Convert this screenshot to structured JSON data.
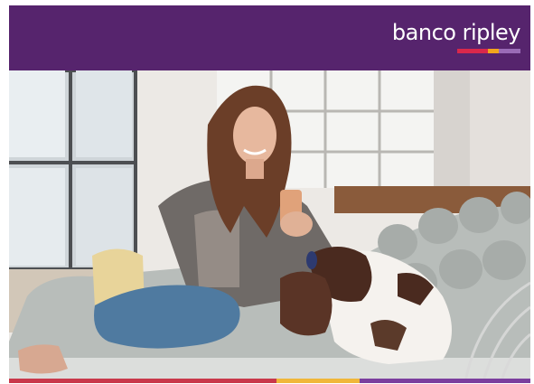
{
  "brand": {
    "name": "banco ripley",
    "colors": {
      "header_bg": "#56246d",
      "bar_red": "#d9284b",
      "bar_orange": "#f2a51c",
      "bar_purple": "#9a6bb6"
    }
  },
  "hero": {
    "icon": "woman-with-phone-and-dog-photo"
  },
  "footer": {
    "stripe_colors": [
      "#c9384b",
      "#f0b73a",
      "#7b3f9e"
    ]
  }
}
